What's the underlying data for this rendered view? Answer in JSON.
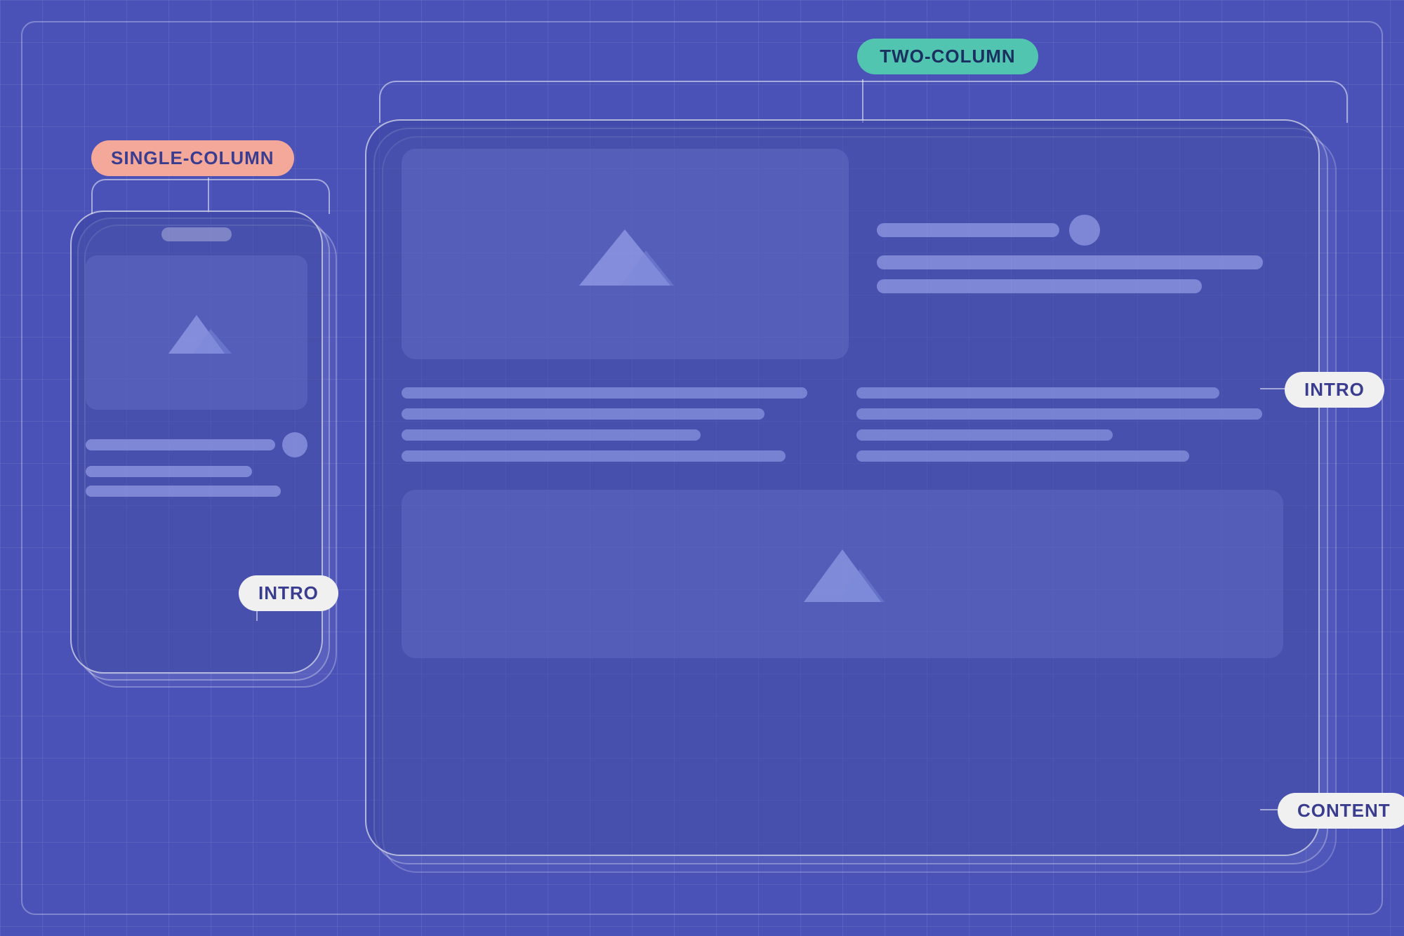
{
  "labels": {
    "single_column": "SINGLE-COLUMN",
    "two_column": "TWO-COLUMN",
    "intro_phone": "INTRO",
    "intro_tablet": "INTRO",
    "content": "CONTENT"
  },
  "colors": {
    "background": "#4a52b8",
    "single_column_tag": "#f4a89a",
    "two_column_tag": "#52c5b0",
    "intro_tag": "#f0f0f0",
    "content_tag": "#f0f0f0",
    "tag_text": "#3a3d8f"
  }
}
